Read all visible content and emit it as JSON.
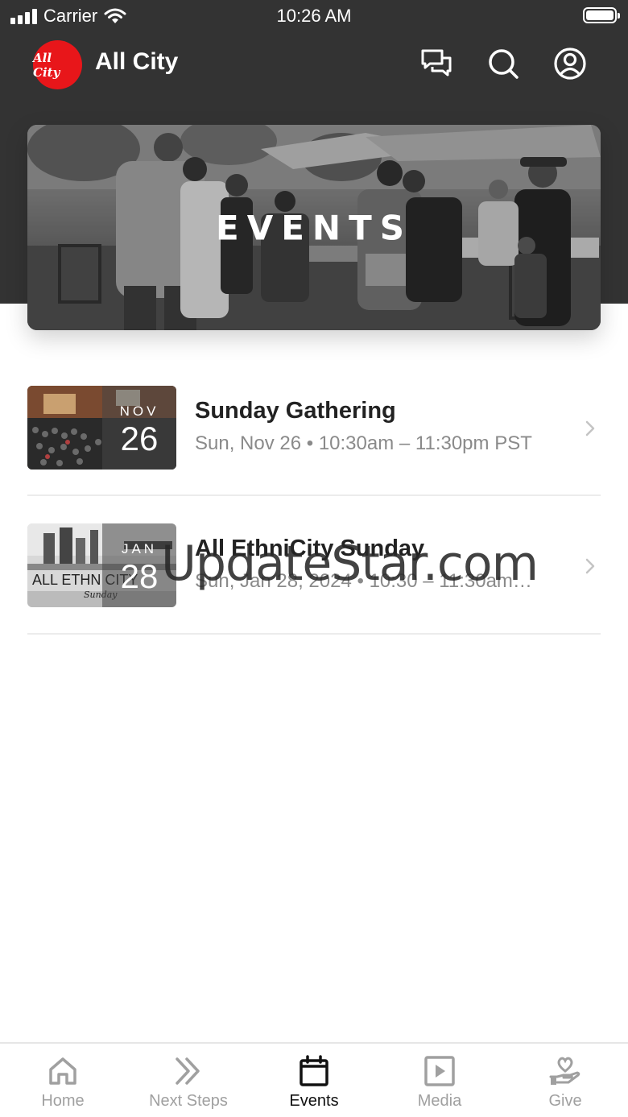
{
  "status_bar": {
    "carrier": "Carrier",
    "time": "10:26 AM"
  },
  "header": {
    "logo_text": "All City",
    "title": "All City",
    "icons": [
      "chat-icon",
      "search-icon",
      "profile-icon"
    ]
  },
  "hero": {
    "title": "EVENTS"
  },
  "events": [
    {
      "month": "NOV",
      "day": "26",
      "title": "Sunday Gathering",
      "meta": "Sun, Nov 26 • 10:30am – 11:30pm PST"
    },
    {
      "month": "JAN",
      "day": "28",
      "thumb_text": "ALL ETHN CITY",
      "thumb_script": "Sunday",
      "title": "All EthniCity Sunday",
      "meta": "Sun, Jan 28, 2024 • 10:30 – 11:30am…"
    }
  ],
  "watermark": "UpdateStar.com",
  "tabs": [
    {
      "label": "Home",
      "icon": "home-icon",
      "active": false
    },
    {
      "label": "Next Steps",
      "icon": "double-chevron-icon",
      "active": false
    },
    {
      "label": "Events",
      "icon": "calendar-icon",
      "active": true
    },
    {
      "label": "Media",
      "icon": "play-icon",
      "active": false
    },
    {
      "label": "Give",
      "icon": "give-heart-hand-icon",
      "active": false
    }
  ],
  "colors": {
    "header_bg": "#333333",
    "brand_red": "#e8161a",
    "tab_active": "#111111",
    "tab_inactive": "#a0a0a0"
  }
}
